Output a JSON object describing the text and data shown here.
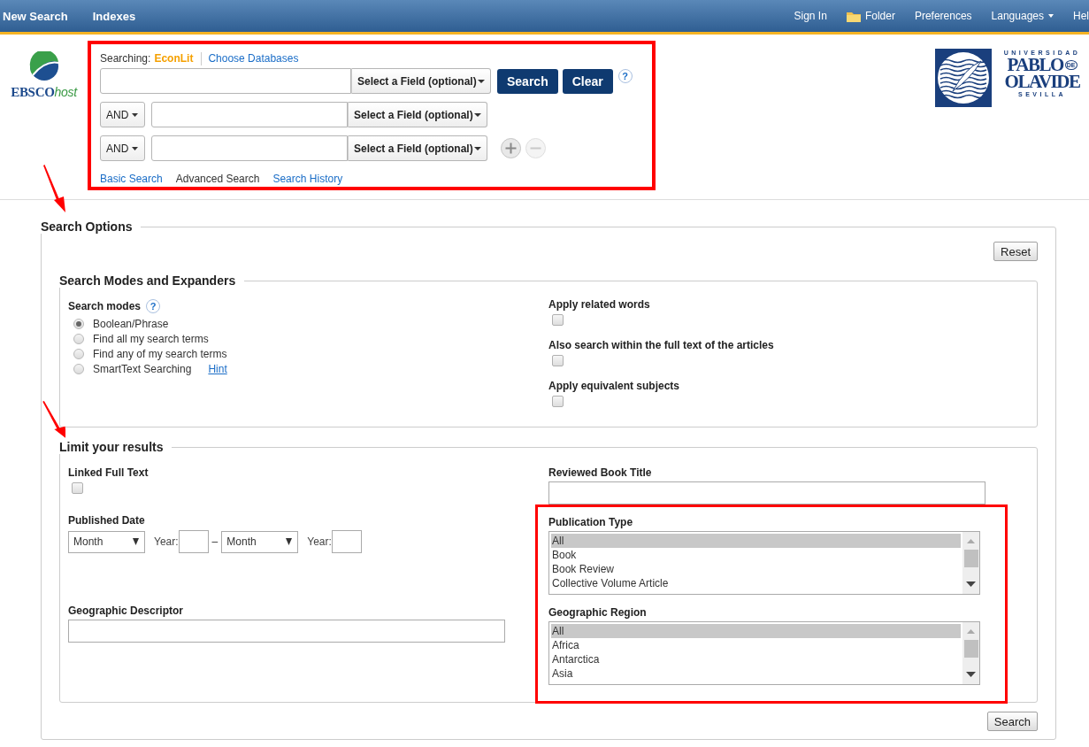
{
  "top_nav": {
    "left_items": [
      {
        "label": "New Search"
      },
      {
        "label": "Indexes"
      }
    ],
    "right_items": [
      {
        "label": "Sign In",
        "kind": "link"
      },
      {
        "label": "Folder",
        "kind": "folder"
      },
      {
        "label": "Preferences",
        "kind": "link"
      },
      {
        "label": "Languages",
        "kind": "menu"
      },
      {
        "label": "Hel",
        "kind": "link"
      }
    ]
  },
  "logo": {
    "text": "EBSCO",
    "suffix": "host"
  },
  "search_panel": {
    "searching_label": "Searching:",
    "database": "EconLit",
    "choose_link": "Choose Databases",
    "rows": [
      {
        "field_select": "Select a Field (optional)"
      },
      {
        "operator": "AND",
        "field_select": "Select a Field (optional)"
      },
      {
        "operator": "AND",
        "field_select": "Select a Field (optional)"
      }
    ],
    "search_button": "Search",
    "clear_button": "Clear",
    "help": "?",
    "tabs": [
      {
        "label": "Basic Search",
        "selected": false
      },
      {
        "label": "Advanced Search",
        "selected": true
      },
      {
        "label": "Search History",
        "selected": false
      }
    ]
  },
  "university_logo": {
    "top_line": "UNIVERSIDAD",
    "name_line_1": "PABLO",
    "name_particle": "DE",
    "name_line_2": "OLAVIDE",
    "bottom_line": "SEVILLA"
  },
  "search_options": {
    "title": "Search Options",
    "reset_button": "Reset",
    "modes_section": {
      "title": "Search Modes and Expanders",
      "modes_label": "Search modes",
      "help": "?",
      "modes": [
        {
          "label": "Boolean/Phrase",
          "selected": true
        },
        {
          "label": "Find all my search terms",
          "selected": false
        },
        {
          "label": "Find any of my search terms",
          "selected": false
        },
        {
          "label": "SmartText Searching",
          "selected": false,
          "link": "Hint"
        }
      ],
      "expanders": [
        {
          "label": "Apply related words",
          "checked": false
        },
        {
          "label": "Also search within the full text of the articles",
          "checked": false
        },
        {
          "label": "Apply equivalent subjects",
          "checked": false
        }
      ]
    },
    "limits_section": {
      "title": "Limit your results",
      "linked_full_text": {
        "label": "Linked Full Text",
        "checked": false
      },
      "published_date": {
        "label": "Published Date",
        "from_month": "Month",
        "from_year_label": "Year:",
        "dash": "–",
        "to_month": "Month",
        "to_year_label": "Year:"
      },
      "geographic_descriptor": {
        "label": "Geographic Descriptor"
      },
      "reviewed_book_title": {
        "label": "Reviewed Book Title"
      },
      "publication_type": {
        "label": "Publication Type",
        "options": [
          {
            "label": "All",
            "selected": true
          },
          {
            "label": "Book",
            "selected": false
          },
          {
            "label": "Book Review",
            "selected": false
          },
          {
            "label": "Collective Volume Article",
            "selected": false
          }
        ]
      },
      "geographic_region": {
        "label": "Geographic Region",
        "options": [
          {
            "label": "All",
            "selected": true
          },
          {
            "label": "Africa",
            "selected": false
          },
          {
            "label": "Antarctica",
            "selected": false
          },
          {
            "label": "Asia",
            "selected": false
          }
        ]
      }
    },
    "search_button": "Search"
  }
}
